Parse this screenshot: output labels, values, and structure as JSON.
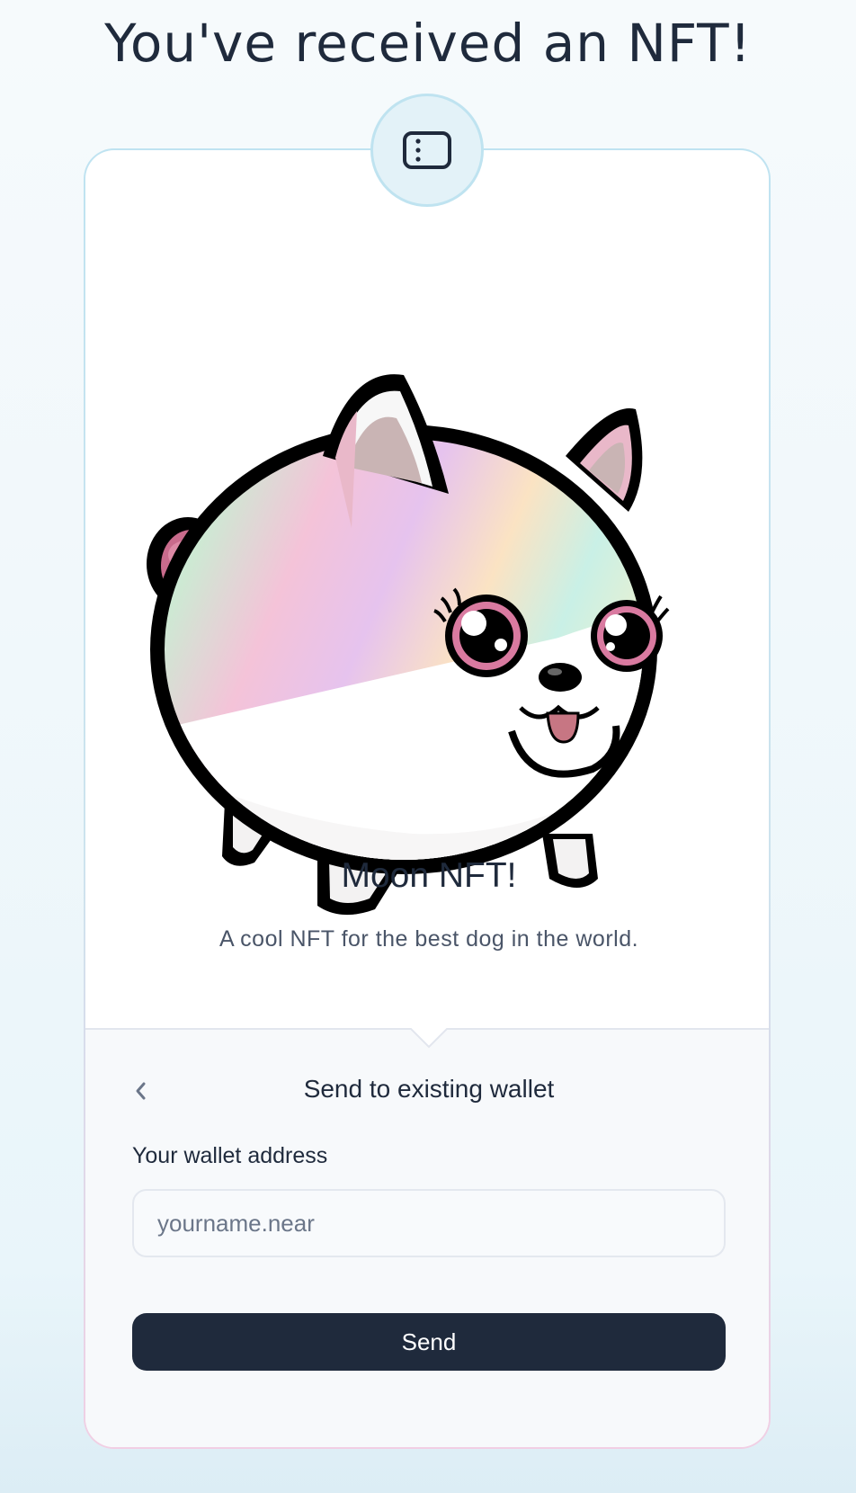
{
  "page": {
    "title": "You've received an NFT!"
  },
  "badge": {
    "icon": "sidebar-panel-icon"
  },
  "nft": {
    "image_icon": "pomeranian-dog-illustration",
    "name": "Moon NFT!",
    "description": "A cool NFT for the best dog in the world."
  },
  "send_panel": {
    "back_icon": "chevron-left-icon",
    "title": "Send to existing wallet",
    "wallet_label": "Your wallet address",
    "wallet_value": "",
    "wallet_placeholder": "yourname.near",
    "send_label": "Send"
  },
  "colors": {
    "primary_dark": "#1f2a3c",
    "badge_fill": "#e3f2f8",
    "badge_border": "#bfe3f0",
    "panel_background": "#f7f9fb"
  }
}
